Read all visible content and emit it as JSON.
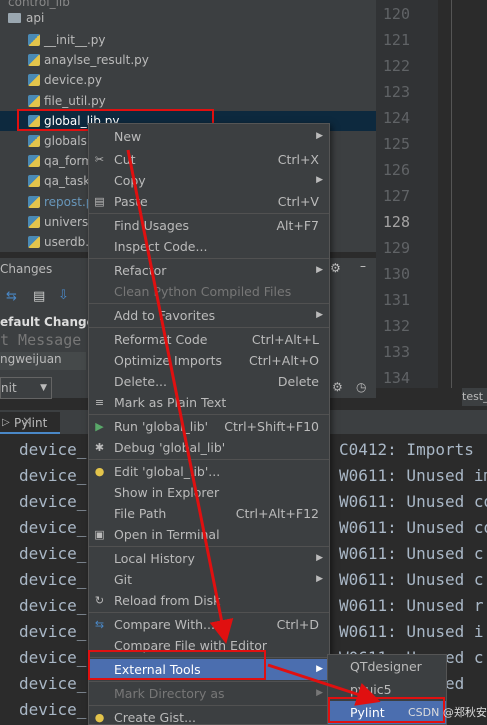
{
  "project_tree": {
    "partial_top": "control_lib",
    "folder": "api",
    "files": [
      "__init__.py",
      "anaylse_result.py",
      "device.py",
      "file_util.py",
      "global_lib.py",
      "globals",
      "qa_form",
      "qa_task",
      "repost.p",
      "universa",
      "userdb."
    ]
  },
  "editor": {
    "line_numbers": [
      "120",
      "121",
      "122",
      "123",
      "124",
      "125",
      "126",
      "127",
      "128",
      "129",
      "130",
      "131",
      "132",
      "133",
      "134"
    ],
    "current_line": "128",
    "tab_partial": "test_"
  },
  "changes_panel": {
    "title": "Changes",
    "changelist": "efault Changel",
    "commit_placeholder": "t Message",
    "author": "ngweijuan",
    "combo_text": "nit"
  },
  "pylint_panel": {
    "tab": "Pylint",
    "rows": [
      {
        "left": "device_",
        "right": "C0412: Imports"
      },
      {
        "left": "device_",
        "right": "W0611: Unused im"
      },
      {
        "left": "device_",
        "right": "W0611: Unused co"
      },
      {
        "left": "device_",
        "right": "W0611: Unused co"
      },
      {
        "left": "device_",
        "right": "W0611: Unused c"
      },
      {
        "left": "device_",
        "right": "W0611: Unused c"
      },
      {
        "left": "device_",
        "right": "W0611: Unused r"
      },
      {
        "left": "device_",
        "right": "W0611: Unused i"
      },
      {
        "left": "device_",
        "right": "W0611: Unused c"
      },
      {
        "left": "device_",
        "right": "W0611: Unused"
      },
      {
        "left": "device_",
        "right": ""
      }
    ]
  },
  "context_menu": {
    "items": [
      {
        "label": "New",
        "shortcut": "",
        "arrow": true
      },
      {
        "label": "Cut",
        "shortcut": "Ctrl+X",
        "icon": "✂"
      },
      {
        "label": "Copy",
        "shortcut": "",
        "arrow": true
      },
      {
        "label": "Paste",
        "shortcut": "Ctrl+V",
        "icon": "▤"
      },
      {
        "label": "Find Usages",
        "shortcut": "Alt+F7"
      },
      {
        "label": "Inspect Code...",
        "shortcut": ""
      },
      {
        "label": "Refactor",
        "shortcut": "",
        "arrow": true
      },
      {
        "label": "Clean Python Compiled Files",
        "shortcut": "",
        "disabled": true
      },
      {
        "label": "Add to Favorites",
        "shortcut": "",
        "arrow": true
      },
      {
        "label": "Reformat Code",
        "shortcut": "Ctrl+Alt+L"
      },
      {
        "label": "Optimize Imports",
        "shortcut": "Ctrl+Alt+O"
      },
      {
        "label": "Delete...",
        "shortcut": "Delete"
      },
      {
        "label": "Mark as Plain Text",
        "shortcut": "",
        "icon": "≡"
      },
      {
        "label": "Run 'global_lib'",
        "shortcut": "Ctrl+Shift+F10",
        "icon": "▶"
      },
      {
        "label": "Debug 'global_lib'",
        "shortcut": "",
        "icon": "✱"
      },
      {
        "label": "Edit 'global_lib'...",
        "shortcut": "",
        "icon": "●"
      },
      {
        "label": "Show in Explorer",
        "shortcut": ""
      },
      {
        "label": "File Path",
        "shortcut": "Ctrl+Alt+F12"
      },
      {
        "label": "Open in Terminal",
        "shortcut": "",
        "icon": "▣"
      },
      {
        "label": "Local History",
        "shortcut": "",
        "arrow": true
      },
      {
        "label": "Git",
        "shortcut": "",
        "arrow": true
      },
      {
        "label": "Reload from Disk",
        "shortcut": "",
        "icon": "↻"
      },
      {
        "label": "Compare With...",
        "shortcut": "Ctrl+D",
        "icon": "⇆"
      },
      {
        "label": "Compare File with Editor",
        "shortcut": ""
      },
      {
        "label": "External Tools",
        "shortcut": "",
        "arrow": true
      },
      {
        "label": "Mark Directory as",
        "shortcut": "",
        "arrow": true,
        "disabled": true
      },
      {
        "label": "Create Gist...",
        "shortcut": "",
        "icon": "●"
      }
    ]
  },
  "submenu": {
    "items": [
      "QTdesigner",
      "pyuic5",
      "Pylint"
    ]
  },
  "watermark": "CSDN @郑秋安"
}
